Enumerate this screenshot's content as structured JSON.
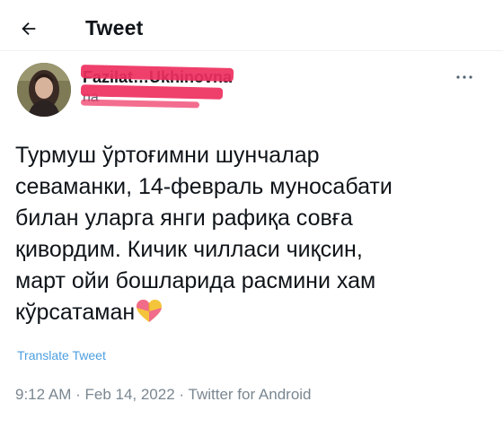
{
  "header": {
    "title": "Tweet",
    "back_icon": "arrow-left-icon"
  },
  "author": {
    "name": "Fazilat…Ukhinovna",
    "name_visible": "novna",
    "handle_visible": "na",
    "avatar_icon": "profile-photo",
    "more_icon": "more-horizontal-icon"
  },
  "tweet": {
    "text": "Турмуш ўртоғимни шунчалар\nсеваманки, 14-февраль муносабати\nбилан уларга янги рафиқа совға\nқивордим. Кичик чилласи чиқсин,\nмарт ойи бошларида расмини хам\nкўрсатаман",
    "emoji": "heart-emoji",
    "translate_label": "Translate Tweet"
  },
  "meta": {
    "time": "9:12 AM",
    "sep1": " · ",
    "date": "Feb 14, 2022",
    "sep2": " · ",
    "source": "Twitter for Android"
  },
  "colors": {
    "link": "#4d9fe0",
    "redaction": "#ee2f5e",
    "text": "#0f1419",
    "muted": "#7a8791"
  }
}
